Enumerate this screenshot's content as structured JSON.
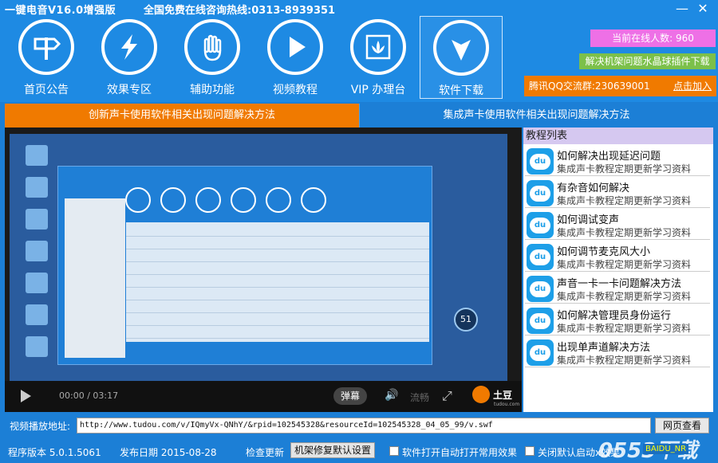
{
  "app": {
    "title": "一键电音V16.0增强版",
    "hotline": "全国免费在线咨询热线:0313-8939351",
    "minimize": "—",
    "close": "✕"
  },
  "nav": [
    {
      "label": "首页公告",
      "icon": "signpost-icon"
    },
    {
      "label": "效果专区",
      "icon": "lightning-icon"
    },
    {
      "label": "辅助功能",
      "icon": "hand-icon"
    },
    {
      "label": "视频教程",
      "icon": "play-icon"
    },
    {
      "label": "VIP 办理台",
      "icon": "lotus-icon"
    },
    {
      "label": "软件下载",
      "icon": "download-icon"
    }
  ],
  "header_right": {
    "online": "当前在线人数: 960",
    "plugin_download": "解决机架问题水晶球插件下载",
    "qq_group": "腾讯QQ交流群:230639001",
    "qq_join": "点击加入"
  },
  "tabs": {
    "tab1": "创新声卡使用软件相关出现问题解决方法",
    "tab2": "集成声卡使用软件相关出现问题解决方法"
  },
  "player": {
    "time": "00:00 / 03:17",
    "danmu": "弹幕",
    "smooth": "流畅",
    "brand": "土豆",
    "brand_sub": "tudou.com",
    "speed": "51"
  },
  "tutorials": {
    "header": "教程列表",
    "items": [
      {
        "title": "如何解决出现延迟问题",
        "sub": "集成声卡教程定期更新学习资料"
      },
      {
        "title": "有杂音如何解决",
        "sub": "集成声卡教程定期更新学习资料"
      },
      {
        "title": "如何调试变声",
        "sub": "集成声卡教程定期更新学习资料"
      },
      {
        "title": "如何调节麦克风大小",
        "sub": "集成声卡教程定期更新学习资料"
      },
      {
        "title": "声音一卡一卡问题解决方法",
        "sub": "集成声卡教程定期更新学习资料"
      },
      {
        "title": "如何解决管理员身份运行",
        "sub": "集成声卡教程定期更新学习资料"
      },
      {
        "title": "出现单声道解决方法",
        "sub": "集成声卡教程定期更新学习资料"
      }
    ],
    "icon_text": "du"
  },
  "url": {
    "label": "视频播放地址:",
    "value": "http://www.tudou.com/v/IQmyVx-QNhY/&rpid=102545328&resourceId=102545328_04_05_99/v.swf",
    "button": "网页查看"
  },
  "status": {
    "version": "程序版本 5.0.1.5061",
    "date": "发布日期 2015-08-28",
    "update": "检查更新",
    "repair_btn": "机架修复默认设置",
    "auto_open": "软件打开自动打开常用效果",
    "disable_boot": "关闭默认启动x效果"
  },
  "watermark": "0553下载",
  "baidu_tag": "BAIDU_NR"
}
